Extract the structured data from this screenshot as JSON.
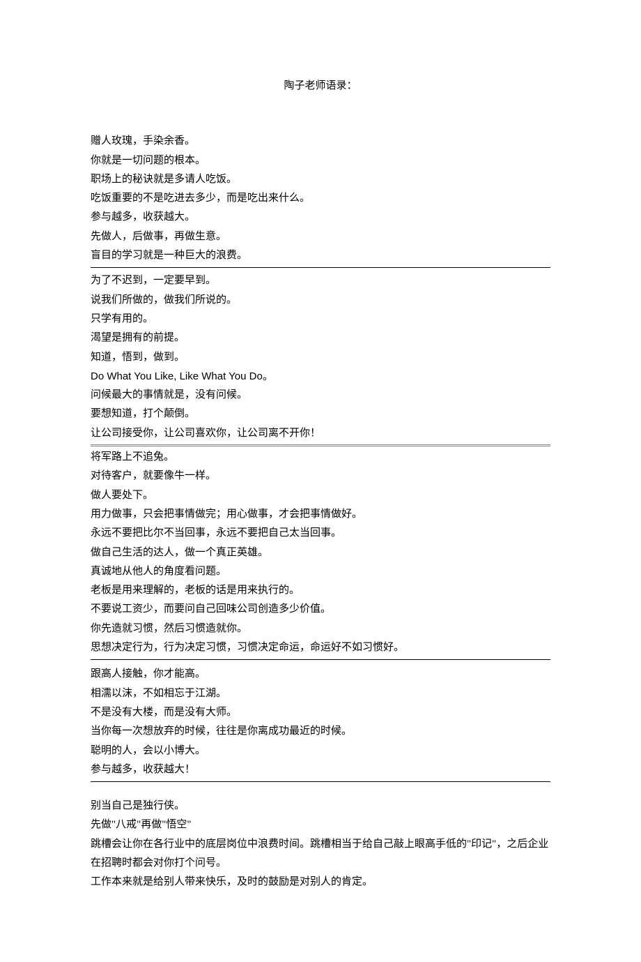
{
  "title": "陶子老师语录：",
  "sections": [
    {
      "lines": [
        "赠人玫瑰，手染余香。",
        "你就是一切问题的根本。",
        "职场上的秘诀就是多请人吃饭。",
        "吃饭重要的不是吃进去多少，而是吃出来什么。",
        "参与越多，收获越大。",
        "先做人，后做事，再做生意。",
        "盲目的学习就是一种巨大的浪费。"
      ],
      "separator": "dash"
    },
    {
      "lines": [
        "为了不迟到，一定要早到。",
        "说我们所做的，做我们所说的。",
        "只学有用的。",
        "渴望是拥有的前提。",
        "知道，悟到，做到。",
        {
          "text": "Do What You Like, Like What You Do。",
          "english": true
        },
        "问候最大的事情就是，没有问候。",
        "要想知道，打个颠倒。",
        "让公司接受你，让公司喜欢你，让公司离不开你！"
      ],
      "separator": "double"
    },
    {
      "lines": [
        "将军路上不追兔。",
        "对待客户，就要像牛一样。",
        "做人要处下。",
        "用力做事，只会把事情做完；用心做事，才会把事情做好。",
        "永远不要把比尔不当回事，永远不要把自己太当回事。",
        "做自己生活的达人，做一个真正英雄。",
        "真诚地从他人的角度看问题。",
        "老板是用来理解的，老板的话是用来执行的。",
        "不要说工资少，而要问自己回味公司创造多少价值。",
        "你先造就习惯，然后习惯造就你。",
        "思想决定行为，行为决定习惯，习惯决定命运，命运好不如习惯好。"
      ],
      "separator": "dash"
    },
    {
      "lines": [
        "跟高人接触，你才能高。",
        "相濡以沫，不如相忘于江湖。",
        "不是没有大楼，而是没有大师。",
        "当你每一次想放弃的时候，往往是你离成功最近的时候。",
        "聪明的人，会以小博大。",
        "参与越多，收获越大！"
      ],
      "separator": "dash"
    },
    {
      "lines": [
        "别当自己是独行侠。",
        "先做\"八戒\"再做\"悟空\"",
        "跳槽会让你在各行业中的底层岗位中浪费时间。跳槽相当于给自己敲上眼高手低的\"印记\"，之后企业在招聘时都会对你打个问号。",
        "工作本来就是给别人带来快乐，及时的鼓励是对别人的肯定。"
      ],
      "separator": "none"
    }
  ]
}
